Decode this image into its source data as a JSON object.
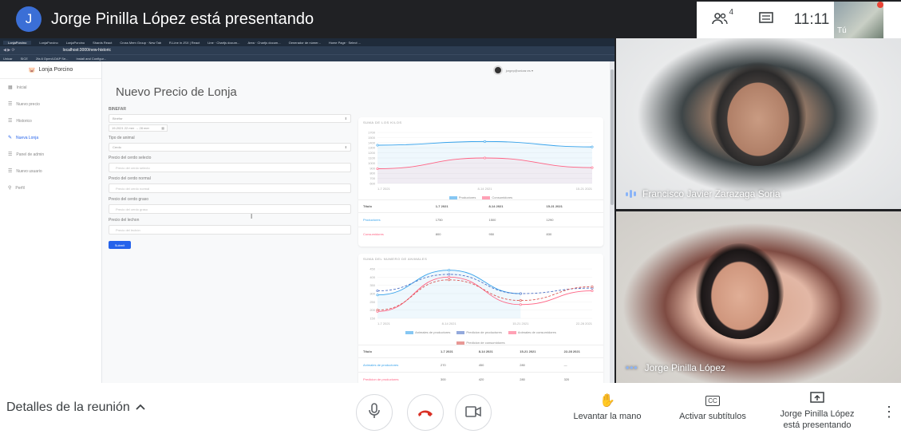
{
  "meet": {
    "presenter_initial": "J",
    "presenting_title": "Jorge Pinilla López está presentando",
    "participant_count": "4",
    "clock": "11:11",
    "self_label": "Tú",
    "people_icon": "people-icon",
    "chat_icon": "chat-icon"
  },
  "browser": {
    "tabs": [
      "LonjaPorcino",
      "LonjaPorcino",
      "LonjaPorcino",
      "Shards React",
      "Cross Mem Group · New Tab",
      "R-Line in JSX | React",
      "Line · Chartjs docum...",
      "Area · Chartjs docum...",
      "Generador de númer...",
      "Home Page · Select ..."
    ],
    "url": "localhost:3000/new-historic",
    "bookmarks": [
      "Unicar",
      "SICE",
      "2fa.6 Open/LDAP Se...",
      "Install and Configur..."
    ]
  },
  "app": {
    "brand": "Lonja Porcino",
    "sidebar": [
      {
        "label": "Inicial",
        "icon": "grid-icon"
      },
      {
        "label": "Nuevo precio",
        "icon": "list-icon"
      },
      {
        "label": "Historico",
        "icon": "list-icon"
      },
      {
        "label": "Nueva Lonja",
        "icon": "pencil-icon"
      },
      {
        "label": "Panel de admin",
        "icon": "list-icon"
      },
      {
        "label": "Nuevo usuario",
        "icon": "list-icon"
      },
      {
        "label": "Perfil",
        "icon": "person-icon"
      }
    ],
    "user_email": "jorgep@unizar.es ▾",
    "page_title": "Nuevo Precio de Lonja",
    "form": {
      "section_label": "BINEFAR",
      "lonja_select": "Binéfar",
      "date_value": "19-2021 22 mer → 28 mer",
      "tipo_label": "Tipo de animal",
      "tipo_value": "Cerdo",
      "fields": [
        {
          "label": "Precio del cerdo selecto",
          "placeholder": "Precio del cerdo selecto"
        },
        {
          "label": "Precio del cerdo normal",
          "placeholder": "Precio del cerdo normal"
        },
        {
          "label": "Precio del cerdo graso",
          "placeholder": "Precio del cerdo graso"
        },
        {
          "label": "Precio del lechon",
          "placeholder": "Precio del lechón"
        }
      ],
      "submit": "Submit"
    },
    "chart1": {
      "title": "SUMA DE LOS KILOS",
      "legend": [
        "Productores",
        "Consumidores"
      ],
      "table_headers": [
        "Título",
        "1-7 2021",
        "8-14 2021",
        "15-21 2021"
      ],
      "rows": [
        {
          "label": "Productores",
          "values": [
            "1750",
            "1500",
            "1290"
          ]
        },
        {
          "label": "Consumidores",
          "values": [
            "800",
            "950",
            "830"
          ]
        }
      ]
    },
    "chart2": {
      "title": "SUMA DEL NUMERO DE ANIMALES",
      "legend": [
        "Animales de productores",
        "Predicion de productores",
        "Animales de consumidores",
        "Predicion de consumidores"
      ],
      "table_headers": [
        "Título",
        "1-7 2021",
        "8-14 2021",
        "15-21 2021",
        "22-28 2021"
      ],
      "rows": [
        {
          "label": "Animales de productores",
          "values": [
            "270",
            "450",
            "280",
            "—"
          ]
        },
        {
          "label": "Predicion de productores",
          "values": [
            "300",
            "420",
            "280",
            "320"
          ]
        }
      ]
    }
  },
  "chart_data": [
    {
      "type": "line",
      "title": "SUMA DE LOS KILOS",
      "categories": [
        "1-7 2021",
        "8-14 2021",
        "15-21 2021"
      ],
      "ylim": [
        0,
        1800
      ],
      "y_ticks": [
        "1700",
        "1500",
        "1400",
        "1300",
        "1200",
        "1100",
        "1000",
        "900",
        "800",
        "700",
        "600"
      ],
      "series": [
        {
          "name": "Productores",
          "values": [
            1350,
            1480,
            1290
          ],
          "color": "#36a2eb"
        },
        {
          "name": "Consumidores",
          "values": [
            520,
            900,
            560
          ],
          "color": "#ff6384"
        }
      ]
    },
    {
      "type": "line",
      "title": "SUMA DEL NUMERO DE ANIMALES",
      "categories": [
        "1-7 2021",
        "8-14 2021",
        "15-21 2021",
        "22-28 2021"
      ],
      "ylim": [
        100,
        460
      ],
      "y_ticks": [
        "450",
        "400",
        "350",
        "300",
        "250",
        "200",
        "150"
      ],
      "series": [
        {
          "name": "Animales de productores",
          "values": [
            270,
            450,
            280,
            null
          ],
          "color": "#36a2eb"
        },
        {
          "name": "Predicion de productores",
          "values": [
            300,
            420,
            280,
            320
          ],
          "color": "#4b6fc4"
        },
        {
          "name": "Animales de consumidores",
          "values": [
            150,
            400,
            200,
            300
          ],
          "color": "#ff6384"
        },
        {
          "name": "Predicion de consumidores",
          "values": [
            160,
            380,
            230,
            330
          ],
          "color": "#d9534f"
        }
      ]
    }
  ],
  "participants": [
    {
      "name": "Francisco Javier Zarazaga Soria"
    },
    {
      "name": "Jorge Pinilla López"
    }
  ],
  "bottom": {
    "details": "Detalles de la reunión",
    "raise_hand": "Levantar la mano",
    "captions": "Activar subtítulos",
    "captions_icon_text": "CC",
    "presenting": "Jorge Pinilla López\nestá presentando"
  }
}
